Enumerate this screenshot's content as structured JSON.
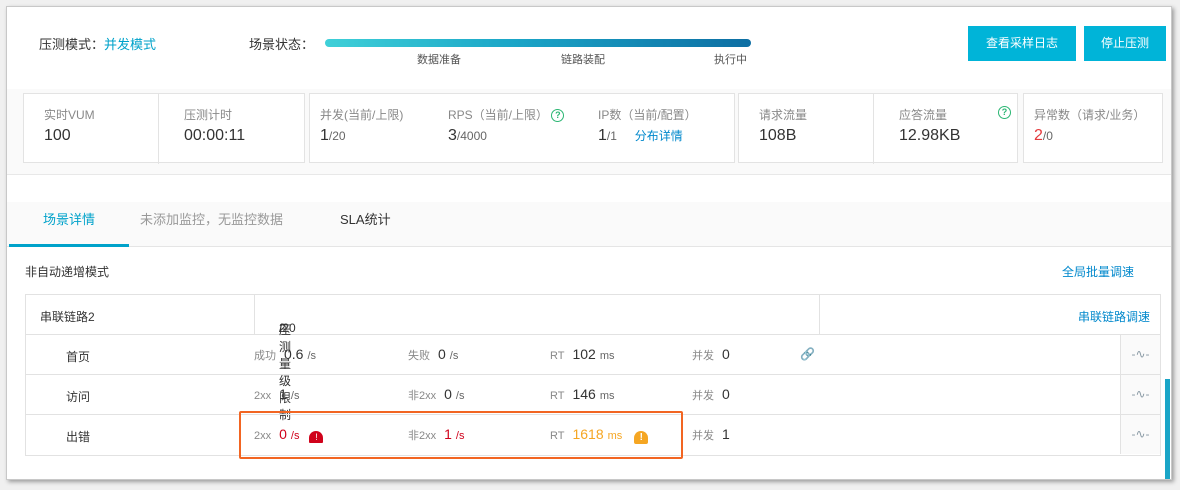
{
  "header": {
    "mode_label": "压测模式：",
    "mode_value": "并发模式",
    "state_label": "场景状态：",
    "steps": [
      "数据准备",
      "链路装配",
      "执行中"
    ],
    "buttons": {
      "log": "查看采样日志",
      "stop": "停止压测"
    }
  },
  "stats": {
    "vum": {
      "label": "实时VUM",
      "value": "100"
    },
    "timer": {
      "label": "压测计时",
      "value": "00:00:11"
    },
    "concurrency": {
      "label": "并发(当前/上限)",
      "current": "1",
      "limit": "/20"
    },
    "rps": {
      "label": "RPS（当前/上限）",
      "current": "3",
      "limit": "/4000"
    },
    "ip": {
      "label": "IP数（当前/配置）",
      "current": "1",
      "limit": "/1",
      "link": "分布详情"
    },
    "request_traffic": {
      "label": "请求流量",
      "value": "108B"
    },
    "response_traffic": {
      "label": "应答流量",
      "value": "12.98KB"
    },
    "errors": {
      "label": "异常数（请求/业务）",
      "request": "2",
      "business": "/0"
    }
  },
  "tabs": [
    "场景详情",
    "未添加监控，无监控数据",
    "SLA统计"
  ],
  "content": {
    "sub_mode": "非自动递增模式",
    "batch_link": "全局批量调速",
    "chain": {
      "name": "串联链路2",
      "limit_label": "压测量级限制",
      "limit_current": "2",
      "limit_total": "/20",
      "adjust_link": "串联链路调速"
    },
    "rows": [
      {
        "name": "首页",
        "m1k": "成功",
        "m1v": "0.6",
        "m1u": "/s",
        "m2k": "失败",
        "m2v": "0",
        "m2u": "/s",
        "rtk": "RT",
        "rtv": "102",
        "rtu": "ms",
        "ck": "并发",
        "cv": "0"
      },
      {
        "name": "访问",
        "m1k": "2xx",
        "m1v": "1",
        "m1u": "/s",
        "m2k": "非2xx",
        "m2v": "0",
        "m2u": "/s",
        "rtk": "RT",
        "rtv": "146",
        "rtu": "ms",
        "ck": "并发",
        "cv": "0"
      },
      {
        "name": "出错",
        "m1k": "2xx",
        "m1v": "0",
        "m1u": "/s",
        "m2k": "非2xx",
        "m2v": "1",
        "m2u": "/s",
        "rtk": "RT",
        "rtv": "1618",
        "rtu": "ms",
        "ck": "并发",
        "cv": "1"
      }
    ]
  },
  "colors": {
    "accent": "#00a2ca",
    "button": "#00b4d8",
    "error": "#d0021b",
    "warning": "#f5a623",
    "highlight": "#f26522"
  },
  "icons": {
    "help": "question-circle-icon",
    "chain": "link-icon",
    "alarm": "alarm-light-icon",
    "warning": "warning-bell-icon",
    "pulse": "pulse-icon"
  }
}
